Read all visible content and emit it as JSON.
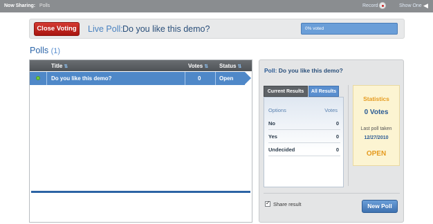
{
  "share_bar": {
    "label": "Now Sharing:",
    "value": "Polls",
    "record_label": "Record",
    "show_one_label": "Show One"
  },
  "live_bar": {
    "close_button": "Close Voting",
    "live_label": "Live Poll:",
    "question": "Do you like this demo?",
    "progress_text": "0% voted",
    "progress_percent": 0
  },
  "polls": {
    "title": "Polls",
    "count": "(1)",
    "columns": {
      "title": "Title",
      "votes": "Votes",
      "status": "Status"
    },
    "rows": [
      {
        "title": "Do you like this demo?",
        "votes": "0",
        "status": "Open"
      }
    ]
  },
  "detail": {
    "poll_label": "Poll:",
    "question": "Do you like this demo?",
    "tabs": {
      "current": "Current Results",
      "all": "All Results"
    },
    "results": {
      "options_header": "Options",
      "votes_header": "Votes",
      "rows": [
        {
          "option": "No",
          "votes": "0"
        },
        {
          "option": "Yes",
          "votes": "0"
        },
        {
          "option": "Undecided",
          "votes": "0"
        }
      ]
    },
    "stats": {
      "title": "Statistics",
      "votes": "0 Votes",
      "last_label": "Last poll taken",
      "last_date": "12/27/2010",
      "status": "OPEN"
    },
    "share_label": "Share result",
    "share_checked": true,
    "new_poll_button": "New Poll"
  },
  "colors": {
    "accent_blue": "#4f88c8",
    "close_red": "#c0241c",
    "stats_orange": "#e59a1e",
    "online_green": "#6fc93b"
  }
}
